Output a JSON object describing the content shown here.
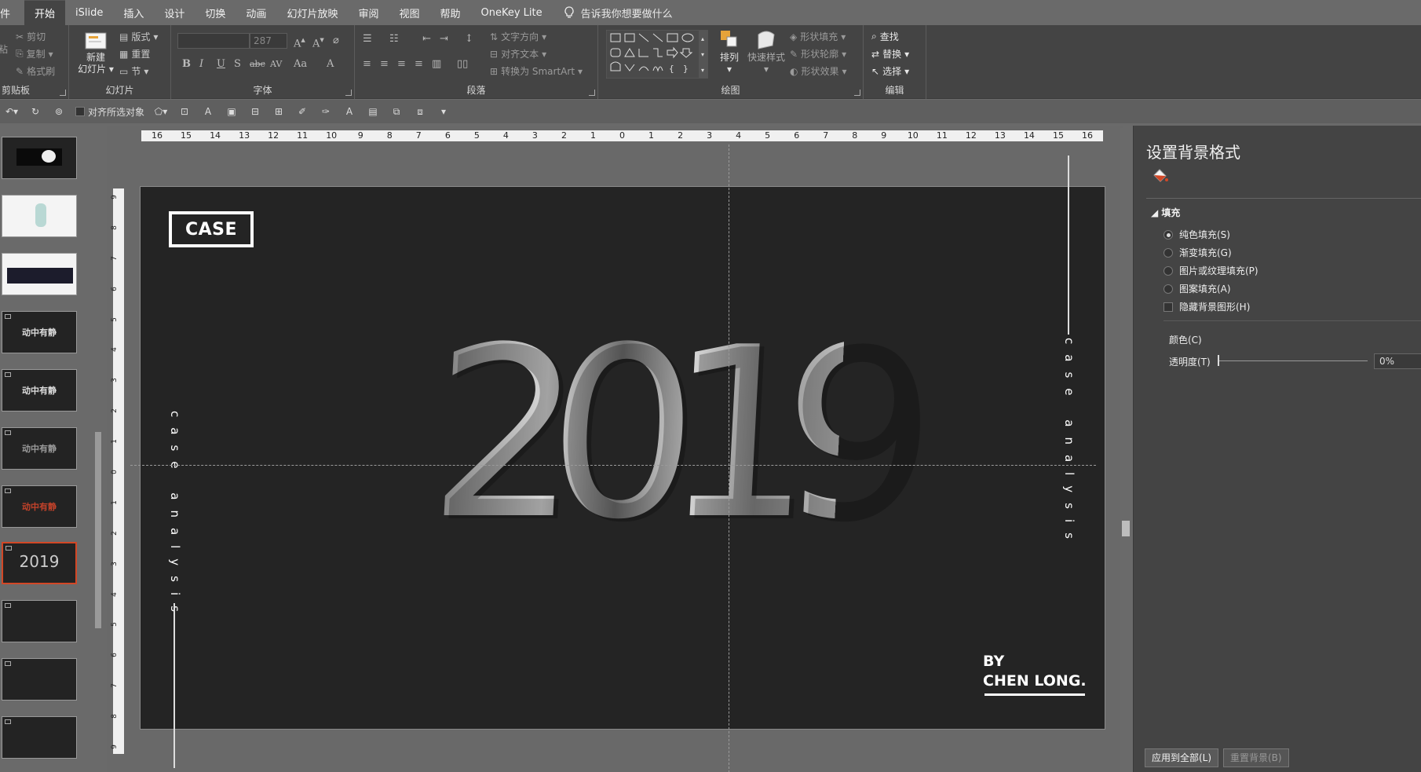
{
  "menu": {
    "file": "件",
    "tabs": [
      "开始",
      "iSlide",
      "插入",
      "设计",
      "切换",
      "动画",
      "幻灯片放映",
      "审阅",
      "视图",
      "帮助",
      "OneKey Lite"
    ],
    "active": "开始",
    "tell_me": "告诉我你想要做什么"
  },
  "ribbon": {
    "clipboard": {
      "cut": "剪切",
      "copy": "复制",
      "painter": "格式刷",
      "paste": "粘",
      "label": "剪贴板"
    },
    "slides": {
      "new_line1": "新建",
      "new_line2": "幻灯片",
      "layout": "版式",
      "reset": "重置",
      "section": "节",
      "label": "幻灯片"
    },
    "font": {
      "name": "",
      "size": "287",
      "label": "字体",
      "bold": "B",
      "italic": "I",
      "underline": "U",
      "shadow": "S",
      "strike": "abc",
      "spacing": "AV",
      "case": "Aa",
      "color": "A"
    },
    "paragraph": {
      "text_dir": "文字方向",
      "align_text": "对齐文本",
      "smartart": "转换为 SmartArt",
      "label": "段落"
    },
    "drawing": {
      "arrange": "排列",
      "quick_styles": "快速样式",
      "fill": "形状填充",
      "outline": "形状轮廓",
      "effects": "形状效果",
      "label": "绘图"
    },
    "editing": {
      "find": "查找",
      "replace": "替换",
      "select": "选择",
      "label": "编辑"
    }
  },
  "qat": {
    "align_label": "对齐所选对象"
  },
  "thumbnails": [
    {
      "text": "",
      "style": "dark-photo"
    },
    {
      "text": "",
      "style": "light"
    },
    {
      "text": "",
      "style": "dark-photo"
    },
    {
      "text": "动中有静",
      "style": "dark"
    },
    {
      "text": "动中有静",
      "style": "dark"
    },
    {
      "text": "动中有静",
      "style": "dark"
    },
    {
      "text": "动中有静",
      "style": "dark-red"
    },
    {
      "text": "2019",
      "style": "active"
    },
    {
      "text": "",
      "style": "dark"
    },
    {
      "text": "",
      "style": "dark"
    },
    {
      "text": "",
      "style": "dark"
    }
  ],
  "ruler": {
    "h_ticks": [
      "16",
      "15",
      "14",
      "13",
      "12",
      "11",
      "10",
      "9",
      "8",
      "7",
      "6",
      "5",
      "4",
      "3",
      "2",
      "1",
      "0",
      "1",
      "2",
      "3",
      "4",
      "5",
      "6",
      "7",
      "8",
      "9",
      "10",
      "11",
      "12",
      "13",
      "14",
      "15",
      "16"
    ],
    "v_ticks": [
      "9",
      "8",
      "7",
      "6",
      "5",
      "4",
      "3",
      "2",
      "1",
      "0",
      "1",
      "2",
      "3",
      "4",
      "5",
      "6",
      "7",
      "8",
      "9"
    ]
  },
  "slide": {
    "case": "CASE",
    "left_vertical": "case analysis",
    "right_vertical": "case analysis",
    "year": "2019",
    "by_line1": "BY",
    "by_line2": "CHEN LONG."
  },
  "pane": {
    "title": "设置背景格式",
    "section": "填充",
    "options": [
      {
        "label": "纯色填充(S)",
        "checked": true
      },
      {
        "label": "渐变填充(G)",
        "checked": false
      },
      {
        "label": "图片或纹理填充(P)",
        "checked": false
      },
      {
        "label": "图案填充(A)",
        "checked": false
      }
    ],
    "hide_graphics": "隐藏背景图形(H)",
    "color_label": "颜色(C)",
    "transparency_label": "透明度(T)",
    "transparency_value": "0%",
    "apply_all": "应用到全部(L)",
    "reset_bg": "重置背景(B)"
  },
  "colors": {
    "accent": "#d24726",
    "slide_bg": "#242424"
  }
}
